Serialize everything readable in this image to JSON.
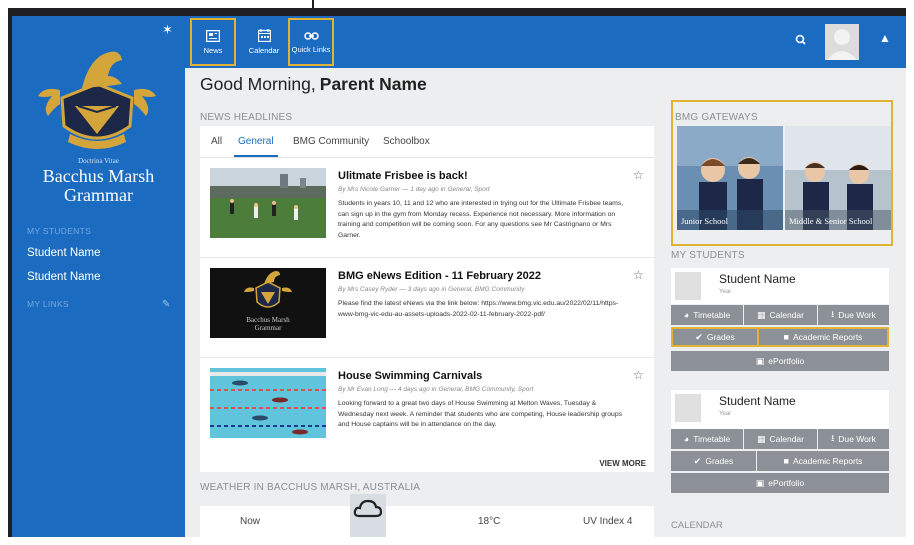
{
  "sidebar": {
    "motto": "Doctrina Vitae",
    "school_line1": "Bacchus Marsh",
    "school_line2": "Grammar",
    "my_students_label": "MY STUDENTS",
    "students": [
      "Student Name",
      "Student Name"
    ],
    "my_links_label": "MY LINKS"
  },
  "topnav": {
    "items": [
      {
        "label": "News",
        "icon": "news-icon",
        "highlighted": true
      },
      {
        "label": "Calendar",
        "icon": "calendar-icon",
        "highlighted": false
      },
      {
        "label": "Quick Links",
        "icon": "link-icon",
        "highlighted": true
      }
    ]
  },
  "greeting": {
    "prefix": "Good Morning,",
    "name": "Parent Name"
  },
  "news": {
    "heading": "NEWS HEADLINES",
    "tabs": [
      "All",
      "General",
      "BMG Community",
      "Schoolbox"
    ],
    "active_tab": "General",
    "articles": [
      {
        "title": "Ulitmate Frisbee is back!",
        "meta": "By Mrs Nicole Garner — 1 day ago in General, Sport",
        "body": "Students in years 10, 11 and 12 who are interested in trying out for the Ultimate Frisbee teams, can sign up in the gym from Monday recess. Experience not necessary. More information on training and competition will be coming soon. For any questions see Mr Castrignano or Mrs Garner."
      },
      {
        "title": "BMG eNews Edition - 11 February 2022",
        "meta": "By Mrs Casey Ryder — 3 days ago in General, BMG Community",
        "body": "Please find the latest eNews via the link below: https://www.bmg.vic.edu.au/2022/02/11/https-www-bmg-vic-edu-au-assets-uploads-2022-02-11-february-2022-pdf/",
        "thumb_line1": "Bacchus Marsh",
        "thumb_line2": "Grammar"
      },
      {
        "title": "House Swimming Carnivals",
        "meta": "By Mr Evan Long — 4 days ago in General, BMG Community, Sport",
        "body": "Looking forward to a great two days of House Swimming at Melton Waves, Tuesday & Wednesday next week. A reminder that students who are competing, House leadership groups and House captains will be in attendance on the day."
      }
    ],
    "view_more": "VIEW MORE"
  },
  "weather": {
    "heading": "WEATHER IN BACCHUS MARSH, AUSTRALIA",
    "when": "Now",
    "temp": "18°C",
    "uv": "UV Index 4",
    "icon": "cloud-icon"
  },
  "gateways": {
    "heading": "BMG GATEWAYS",
    "junior": "Junior School",
    "senior": "Middle & Senior School"
  },
  "my_students": {
    "heading": "MY STUDENTS",
    "cards": [
      {
        "name": "Student Name",
        "year": "Year"
      },
      {
        "name": "Student Name",
        "year": "Year"
      }
    ],
    "buttons": {
      "timetable": "Timetable",
      "calendar": "Calendar",
      "due_work": "Due Work",
      "grades": "Grades",
      "academic_reports": "Academic Reports",
      "eportfolio": "ePortfolio"
    }
  },
  "calendar_heading": "CALENDAR",
  "colors": {
    "brand_blue": "#1b6cc1",
    "highlight": "#e2b234",
    "button_grey": "#8b9196"
  }
}
